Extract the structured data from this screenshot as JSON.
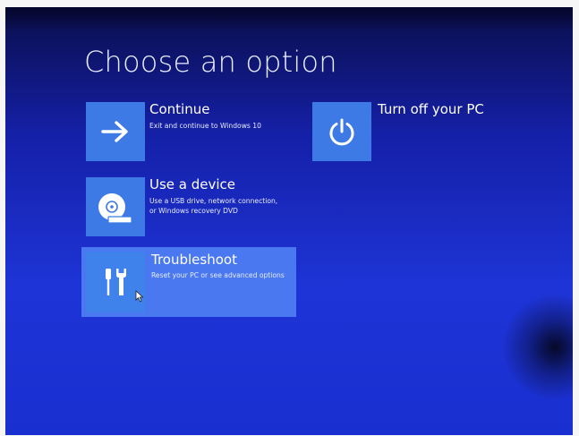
{
  "page": {
    "title": "Choose an option"
  },
  "options": {
    "continue": {
      "title": "Continue",
      "desc": "Exit and continue to Windows 10",
      "icon": "arrow-right-icon"
    },
    "device": {
      "title": "Use a device",
      "desc_line1": "Use a USB drive, network connection,",
      "desc_line2": "or Windows recovery DVD",
      "icon": "disc-drive-icon"
    },
    "troubleshoot": {
      "title": "Troubleshoot",
      "desc": "Reset your PC or see advanced options",
      "icon": "tools-icon",
      "selected": true
    },
    "turnoff": {
      "title": "Turn off your PC",
      "icon": "power-icon"
    }
  },
  "colors": {
    "background": "#1e34d6",
    "tile": "#3e7ae6",
    "selected_highlight": "#4a78f0",
    "text": "#ffffff"
  }
}
